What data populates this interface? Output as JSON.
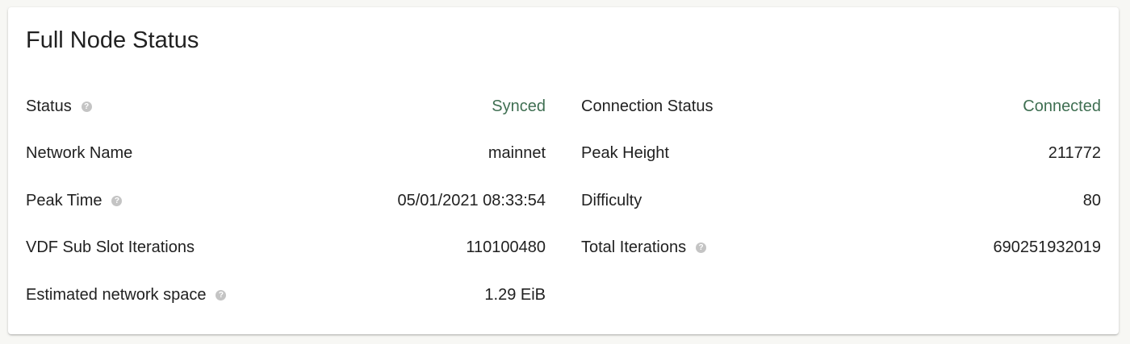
{
  "card": {
    "title": "Full Node Status"
  },
  "colors": {
    "status_green": "#3f6f52",
    "help_icon": "#c4c4c4"
  },
  "rows": [
    {
      "label": "Status",
      "value": "Synced",
      "help": true,
      "green": true
    },
    {
      "label": "Connection Status",
      "value": "Connected",
      "help": false,
      "green": true
    },
    {
      "label": "Network Name",
      "value": "mainnet",
      "help": false,
      "green": false
    },
    {
      "label": "Peak Height",
      "value": "211772",
      "help": false,
      "green": false
    },
    {
      "label": "Peak Time",
      "value": "05/01/2021 08:33:54",
      "help": true,
      "green": false
    },
    {
      "label": "Difficulty",
      "value": "80",
      "help": false,
      "green": false
    },
    {
      "label": "VDF Sub Slot Iterations",
      "value": "110100480",
      "help": false,
      "green": false
    },
    {
      "label": "Total Iterations",
      "value": "690251932019",
      "help": true,
      "green": false
    },
    {
      "label": "Estimated network space",
      "value": "1.29 EiB",
      "help": true,
      "green": false
    }
  ],
  "help_icon_glyph": "?"
}
